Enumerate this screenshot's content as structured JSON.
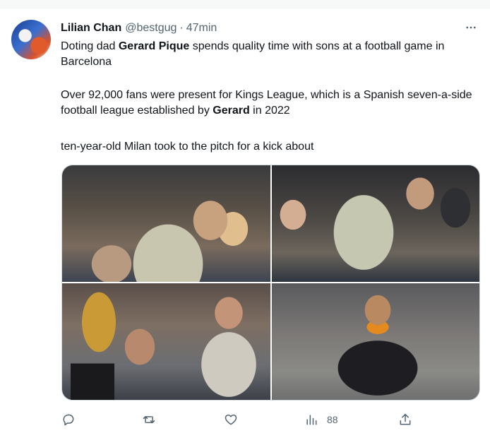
{
  "tweet": {
    "author_name": "Lilian Chan",
    "handle": "@bestgug",
    "separator": "·",
    "time": "47min",
    "paragraph1": {
      "part1": "Doting dad ",
      "bold1": "Gerard Pique",
      "part2": " spends quality time with sons at a football game in Barcelona"
    },
    "paragraph2": {
      "part1": " Over 92,000 fans were present for Kings League, which is a Spanish seven-a-side football league established by ",
      "bold1": "Gerard",
      "part2": " in 2022"
    },
    "paragraph3": "ten-year-old Milan took to the pitch for a kick about"
  },
  "actions": {
    "views_count": "88"
  },
  "icons": {
    "more": "more-horizontal-icon",
    "reply": "reply-icon",
    "retweet": "retweet-icon",
    "like": "heart-icon",
    "views": "views-bar-icon",
    "share": "share-icon"
  },
  "colors": {
    "text_primary": "#0f1419",
    "text_secondary": "#536471",
    "border": "#cfd9de"
  }
}
